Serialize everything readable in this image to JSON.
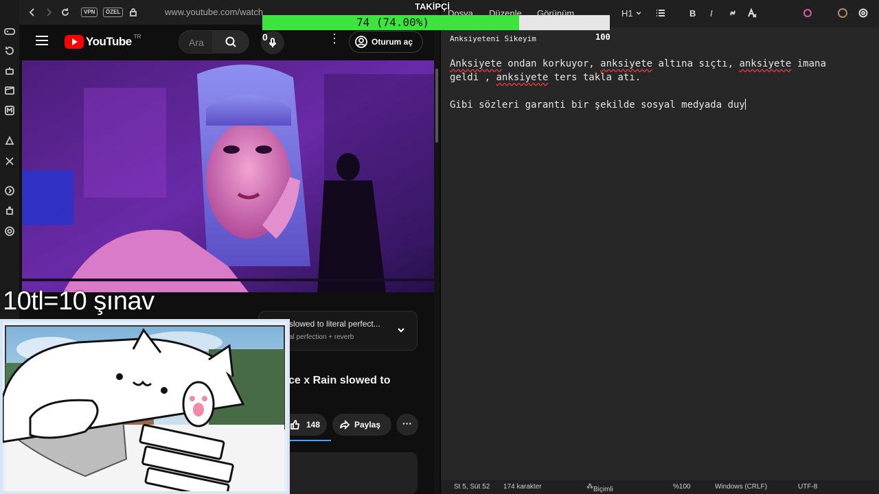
{
  "browser": {
    "url": "www.youtube.com/watch",
    "vpn_label": "VPN",
    "ozel_label": "ÖZEL"
  },
  "youtube": {
    "logo_text": "YouTube",
    "region": "TR",
    "search_placeholder": "Ara",
    "signin_label": "Oturum aç",
    "mic_overlay_count": "0",
    "playlist_title": "slowed to literal perfect...",
    "playlist_subtitle": "al perfection + reverb",
    "video_title": "ce x Rain slowed to",
    "like_count": "148",
    "share_label": "Paylaş"
  },
  "stream_overlay": {
    "caption": "10tl=10 şınav",
    "follower_title": "TAKİPÇİ",
    "follower_progress_label": "74 (74.00%)",
    "follower_count": 74,
    "follower_goal": "100",
    "progress_fraction": 0.74,
    "fill_color": "#3fe33f"
  },
  "editor": {
    "menu": [
      "Dosya",
      "Düzenle",
      "Görünüm"
    ],
    "heading_tool": "H1",
    "doc_title": "Anksiyeteni Sikeyim",
    "line1_words": [
      "Anksiyete",
      " ondan korkuyor, ",
      "anksiyete",
      " altına sıçtı, ",
      "anksiyete",
      " imana"
    ],
    "line2_words": [
      "geldi , ",
      "anksiyete",
      " ters takla atı."
    ],
    "line3": "Gibi sözleri garanti bir şekilde sosyal medyada duy",
    "status": {
      "position": "St 5, Süt 52",
      "chars": "174 karakter",
      "format": "Biçimli",
      "zoom": "%100",
      "line_ending": "Windows (CRLF)",
      "encoding": "UTF-8"
    }
  }
}
